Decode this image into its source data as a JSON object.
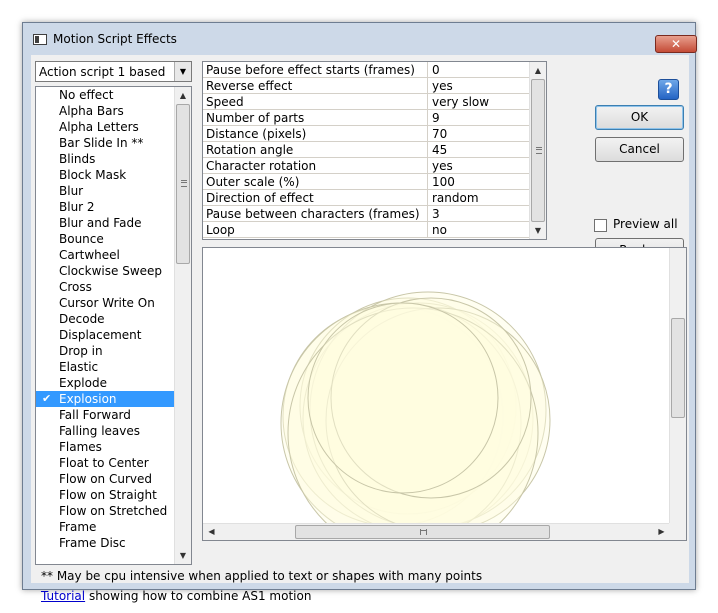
{
  "window": {
    "title": "Motion Script Effects",
    "close_glyph": "✕",
    "help_glyph": "?"
  },
  "mode_select": {
    "value": "Action script 1 based"
  },
  "effects": {
    "items": [
      "No effect",
      "Alpha Bars",
      "Alpha Letters",
      "Bar Slide In **",
      "Blinds",
      "Block Mask",
      "Blur",
      "Blur 2",
      "Blur and Fade",
      "Bounce",
      "Cartwheel",
      "Clockwise Sweep",
      "Cross",
      "Cursor Write On",
      "Decode",
      "Displacement",
      "Drop in",
      "Elastic",
      "Explode",
      "Explosion",
      "Fall Forward",
      "Falling leaves",
      "Flames",
      "Float to Center",
      "Flow on Curved",
      "Flow on Straight",
      "Flow on Stretched",
      "Frame",
      "Frame Disc"
    ],
    "selected": "Explosion"
  },
  "properties": [
    {
      "name": "Pause before effect starts (frames)",
      "value": "0"
    },
    {
      "name": "Reverse effect",
      "value": "yes"
    },
    {
      "name": "Speed",
      "value": "very slow"
    },
    {
      "name": "Number of parts",
      "value": "9"
    },
    {
      "name": "Distance (pixels)",
      "value": "70"
    },
    {
      "name": "Rotation angle",
      "value": "45"
    },
    {
      "name": "Character rotation",
      "value": "yes"
    },
    {
      "name": "Outer scale (%)",
      "value": "100"
    },
    {
      "name": "Direction of effect",
      "value": "random"
    },
    {
      "name": "Pause between characters (frames)",
      "value": "3"
    },
    {
      "name": "Loop",
      "value": "no"
    }
  ],
  "buttons": {
    "ok": "OK",
    "cancel": "Cancel",
    "replay": "Replay"
  },
  "preview_all": {
    "label": "Preview all",
    "checked": false
  },
  "footer": {
    "note": "** May be cpu intensive when applied to text or shapes with many points",
    "tutorial_link": "Tutorial",
    "tutorial_text": " showing how to combine AS1 motion"
  },
  "colors": {
    "selection": "#3399ff",
    "preview_fill": "#fefde0",
    "preview_stroke": "#c8c6a8"
  }
}
